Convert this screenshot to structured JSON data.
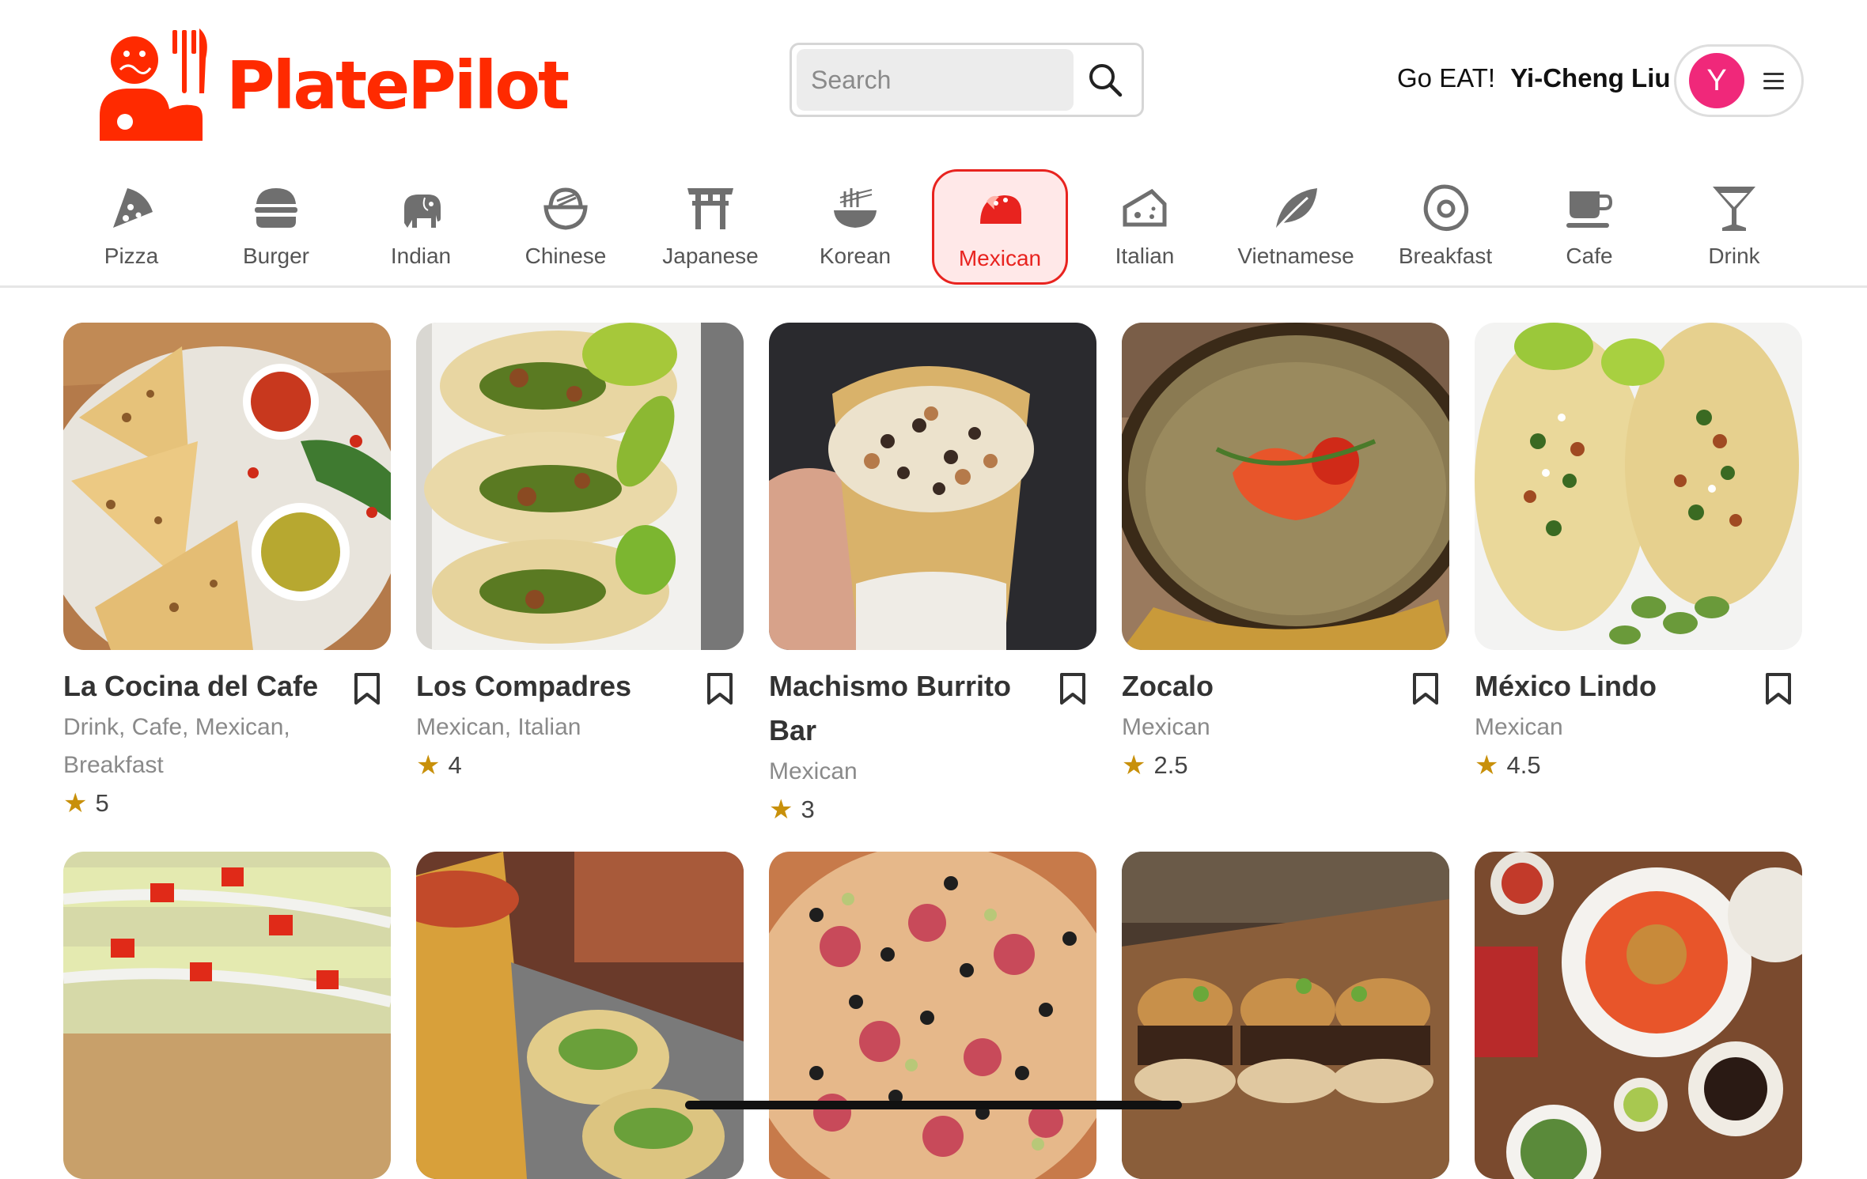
{
  "app": {
    "name": "PlatePilot",
    "brand_color": "#ff2a00"
  },
  "search": {
    "placeholder": "Search"
  },
  "greeting": {
    "prefix": "Go EAT!",
    "user_name": "Yi-Cheng Liu",
    "avatar_initial": "Y",
    "avatar_color": "#f0287a"
  },
  "categories": [
    {
      "label": "Pizza",
      "icon": "pizza-icon"
    },
    {
      "label": "Burger",
      "icon": "burger-icon"
    },
    {
      "label": "Indian",
      "icon": "elephant-icon"
    },
    {
      "label": "Chinese",
      "icon": "rice-bowl-icon"
    },
    {
      "label": "Japanese",
      "icon": "torii-icon"
    },
    {
      "label": "Korean",
      "icon": "noodles-icon"
    },
    {
      "label": "Mexican",
      "icon": "taco-icon",
      "active": true
    },
    {
      "label": "Italian",
      "icon": "cheese-icon"
    },
    {
      "label": "Vietnamese",
      "icon": "leaf-icon"
    },
    {
      "label": "Breakfast",
      "icon": "egg-icon"
    },
    {
      "label": "Cafe",
      "icon": "coffee-icon"
    },
    {
      "label": "Drink",
      "icon": "cocktail-icon"
    }
  ],
  "restaurants": [
    {
      "name": "La Cocina del Cafe",
      "tags": "Drink, Cafe, Mexican, Breakfast",
      "rating": "5",
      "image": "quesadilla-photo"
    },
    {
      "name": "Los Compadres",
      "tags": "Mexican, Italian",
      "rating": "4",
      "image": "tacos-tray-photo"
    },
    {
      "name": "Machismo Burrito Bar",
      "tags": "Mexican",
      "rating": "3",
      "image": "burrito-photo"
    },
    {
      "name": "Zocalo",
      "tags": "Mexican",
      "rating": "2.5",
      "image": "margarita-photo"
    },
    {
      "name": "México Lindo",
      "tags": "Mexican",
      "rating": "4.5",
      "image": "street-tacos-photo"
    },
    {
      "image": "taquitos-photo"
    },
    {
      "image": "tacos-drink-photo"
    },
    {
      "image": "pizza-photo"
    },
    {
      "image": "sliders-photo"
    },
    {
      "image": "table-spread-photo"
    }
  ]
}
